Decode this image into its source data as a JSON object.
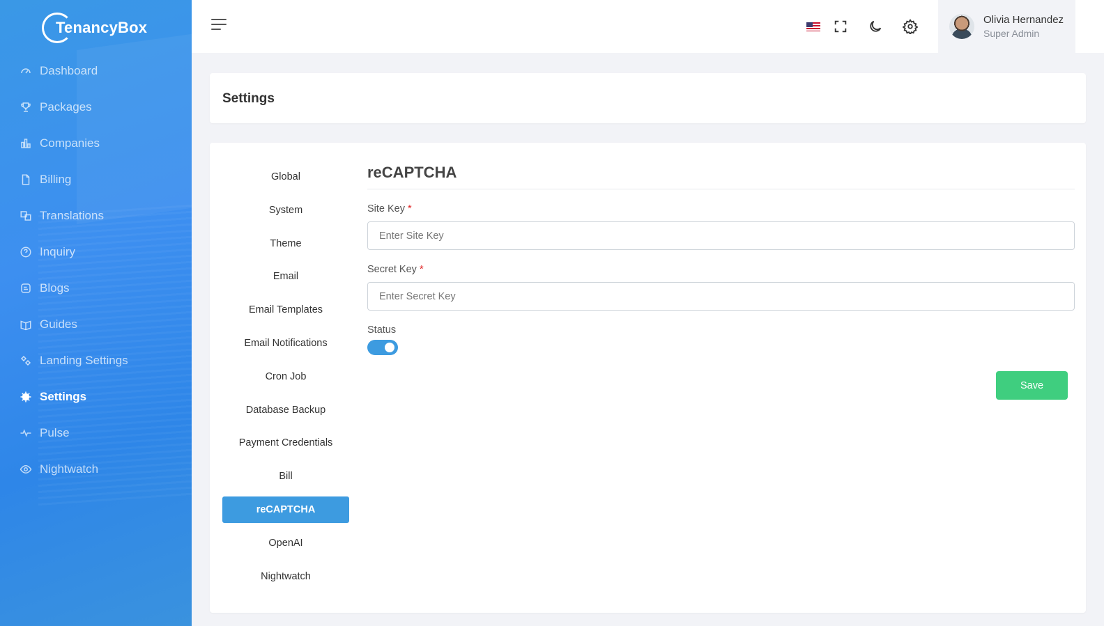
{
  "brand": {
    "name": "TenancyBox"
  },
  "sidebar": {
    "items": [
      {
        "label": "Dashboard",
        "icon": "dashboard-gauge-icon"
      },
      {
        "label": "Packages",
        "icon": "trophy-icon"
      },
      {
        "label": "Companies",
        "icon": "bar-chart-icon"
      },
      {
        "label": "Billing",
        "icon": "document-icon"
      },
      {
        "label": "Translations",
        "icon": "translate-icon"
      },
      {
        "label": "Inquiry",
        "icon": "question-circle-icon"
      },
      {
        "label": "Blogs",
        "icon": "blog-icon"
      },
      {
        "label": "Guides",
        "icon": "book-icon"
      },
      {
        "label": "Landing Settings",
        "icon": "gears-icon"
      },
      {
        "label": "Settings",
        "icon": "gear-icon",
        "active": true
      },
      {
        "label": "Pulse",
        "icon": "pulse-icon"
      },
      {
        "label": "Nightwatch",
        "icon": "eye-icon"
      }
    ]
  },
  "topbar": {
    "icons": [
      "menu-icon",
      "us-flag-icon",
      "fullscreen-icon",
      "moon-icon",
      "settings-gear-icon"
    ],
    "user": {
      "name": "Olivia Hernandez",
      "role": "Super Admin"
    }
  },
  "page": {
    "title": "Settings"
  },
  "settings_nav": {
    "items": [
      "Global",
      "System",
      "Theme",
      "Email",
      "Email Templates",
      "Email Notifications",
      "Cron Job",
      "Database Backup",
      "Payment Credentials",
      "Bill",
      "reCAPTCHA",
      "OpenAI",
      "Nightwatch"
    ],
    "active": "reCAPTCHA"
  },
  "recaptcha": {
    "title": "reCAPTCHA",
    "site_key_label": "Site Key",
    "site_key_placeholder": "Enter Site Key",
    "site_key_value": "",
    "secret_key_label": "Secret Key",
    "secret_key_placeholder": "Enter Secret Key",
    "secret_key_value": "",
    "required_mark": "*",
    "status_label": "Status",
    "status_enabled": true,
    "save_label": "Save"
  },
  "colors": {
    "primary": "#3d9be0",
    "sidebar": "#3d8ff0",
    "save": "#3fce7f",
    "required": "#e02424"
  }
}
